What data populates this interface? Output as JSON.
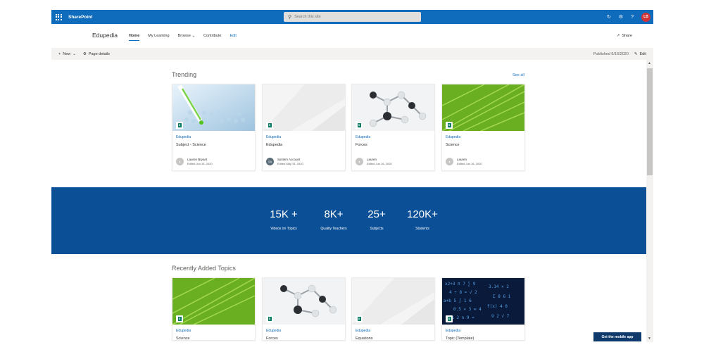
{
  "suite": {
    "brand": "SharePoint",
    "search_placeholder": "Search this site",
    "avatar_initials": "LB",
    "brand_color": "#0f6cbd"
  },
  "site": {
    "title": "Edupedia",
    "nav": [
      "Home",
      "My Learning",
      "Browse",
      "Contribute",
      "Edit"
    ],
    "share": "Share"
  },
  "command_bar": {
    "new": "New",
    "page_details": "Page details",
    "published": "Published 6/16/2020",
    "edit": "Edit"
  },
  "trending": {
    "title": "Trending",
    "see_all": "See all",
    "cards": [
      {
        "site": "Edupedia",
        "title": "Subject - Science",
        "author": "Lauren Bryant",
        "date": "Edited Jun 16, 2020",
        "initials": ""
      },
      {
        "site": "Edupedia",
        "title": "Edupedia",
        "author": "System Account",
        "date": "Edited May 31, 2020",
        "initials": "SA"
      },
      {
        "site": "Edupedia",
        "title": "Forces",
        "author": "Lauren",
        "date": "Edited Jun 16, 2020",
        "initials": ""
      },
      {
        "site": "Edupedia",
        "title": "Science",
        "author": "Lauren",
        "date": "Edited Jun 16, 2020",
        "initials": ""
      }
    ]
  },
  "stats": [
    {
      "value": "15K +",
      "label": "Videos on Topics"
    },
    {
      "value": "8K+",
      "label": "Quality Teachers"
    },
    {
      "value": "25+",
      "label": "Subjects"
    },
    {
      "value": "120K+",
      "label": "Students"
    }
  ],
  "recent": {
    "title": "Recently Added Topics",
    "cards": [
      {
        "site": "Edupedia",
        "title": "Science"
      },
      {
        "site": "Edupedia",
        "title": "Forces"
      },
      {
        "site": "Edupedia",
        "title": "Equations"
      },
      {
        "site": "Edupedia",
        "title": "Topic (Template)"
      }
    ]
  },
  "mobile_app": "Get the mobile app"
}
